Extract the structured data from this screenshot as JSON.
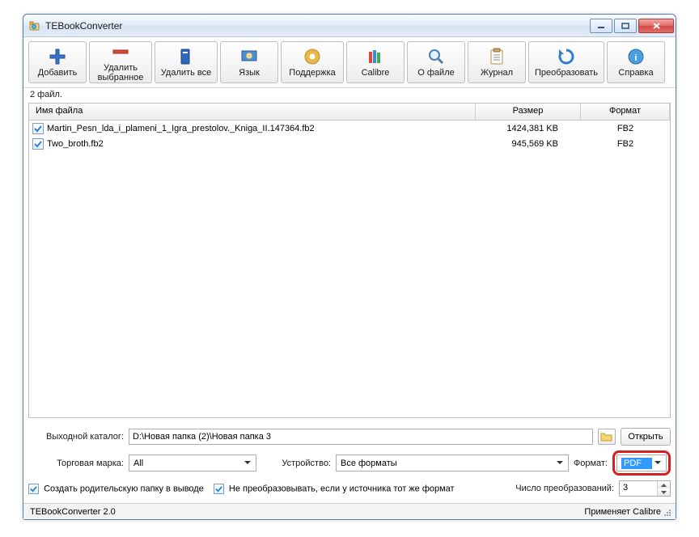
{
  "title": "TEBookConverter",
  "toolbar": {
    "add": "Добавить",
    "removeSelected": "Удалить\nвыбранное",
    "removeAll": "Удалить все",
    "language": "Язык",
    "support": "Поддержка",
    "calibre": "Calibre",
    "about": "О файле",
    "log": "Журнал",
    "convert": "Преобразовать",
    "help": "Справка"
  },
  "fileCount": "2 файл.",
  "columns": {
    "name": "Имя файла",
    "size": "Размер",
    "format": "Формат"
  },
  "files": [
    {
      "checked": true,
      "name": "Martin_Pesn_lda_i_plameni_1_Igra_prestolov._Kniga_II.147364.fb2",
      "size": "1424,381 KB",
      "format": "FB2"
    },
    {
      "checked": true,
      "name": "Two_broth.fb2",
      "size": "945,569 KB",
      "format": "FB2"
    }
  ],
  "bottom": {
    "outputLabel": "Выходной каталог:",
    "outputPath": "D:\\Новая папка (2)\\Новая папка 3",
    "openBtn": "Открыть",
    "brandLabel": "Торговая марка:",
    "brandValue": "All",
    "deviceLabel": "Устройство:",
    "deviceValue": "Все форматы",
    "formatLabel": "Формат:",
    "formatValue": "PDF",
    "chkParentFolder": "Создать родительскую папку в выводе",
    "chkSkipSame": "Не преобразовывать, если у источника тот же формат",
    "convCountLabel": "Число преобразований:",
    "convCount": "3"
  },
  "status": {
    "left": "TEBookConverter 2.0",
    "right": "Применяет Calibre"
  }
}
